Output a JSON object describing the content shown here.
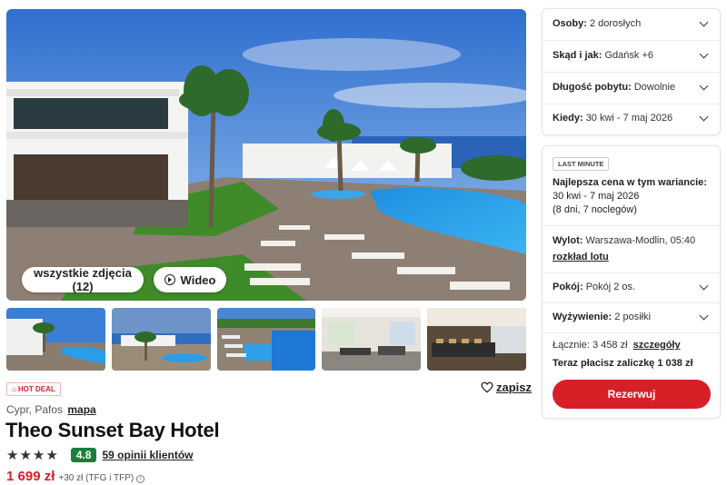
{
  "gallery": {
    "all_photos_label": "wszystkie zdjęcia (12)",
    "video_label": "Wideo"
  },
  "hotel": {
    "hot_deal": "HOT DEAL",
    "save_label": "zapisz",
    "country_region": "Cypr, Pafos",
    "map_link": "mapa",
    "name": "Theo Sunset Bay Hotel",
    "stars": "★★★★",
    "star_rating": 4,
    "score": "4.8",
    "reviews_link": "59 opinii klientów",
    "price": "1 699 zł",
    "price_extra": "+30 zł (TFG i TFP)"
  },
  "filters": [
    {
      "label": "Osoby:",
      "value": "2 dorosłych"
    },
    {
      "label": "Skąd i jak:",
      "value": "Gdańsk +6"
    },
    {
      "label": "Długość pobytu:",
      "value": "Dowolnie"
    },
    {
      "label": "Kiedy:",
      "value": "30 kwi - 7 maj 2026"
    }
  ],
  "offer": {
    "badge": "LAST MINUTE",
    "best_price_label": "Najlepsza cena w tym wariancie:",
    "dates": "30 kwi - 7 maj 2026",
    "duration": "(8 dni, 7 noclegów)",
    "departure_label": "Wylot:",
    "departure_value": "Warszawa-Modlin, 05:40",
    "flight_schedule_link": "rozkład lotu",
    "room_label": "Pokój:",
    "room_value": "Pokój 2 os.",
    "meals_label": "Wyżywienie:",
    "meals_value": "2 posiłki",
    "total_label": "Łącznie: 3 458 zł",
    "details_link": "szczegóły",
    "deposit": "Teraz płacisz zaliczkę 1 038 zł",
    "reserve_button": "Rezerwuj"
  },
  "colors": {
    "brand_red": "#d71f27",
    "score_green": "#1a7f3c"
  }
}
